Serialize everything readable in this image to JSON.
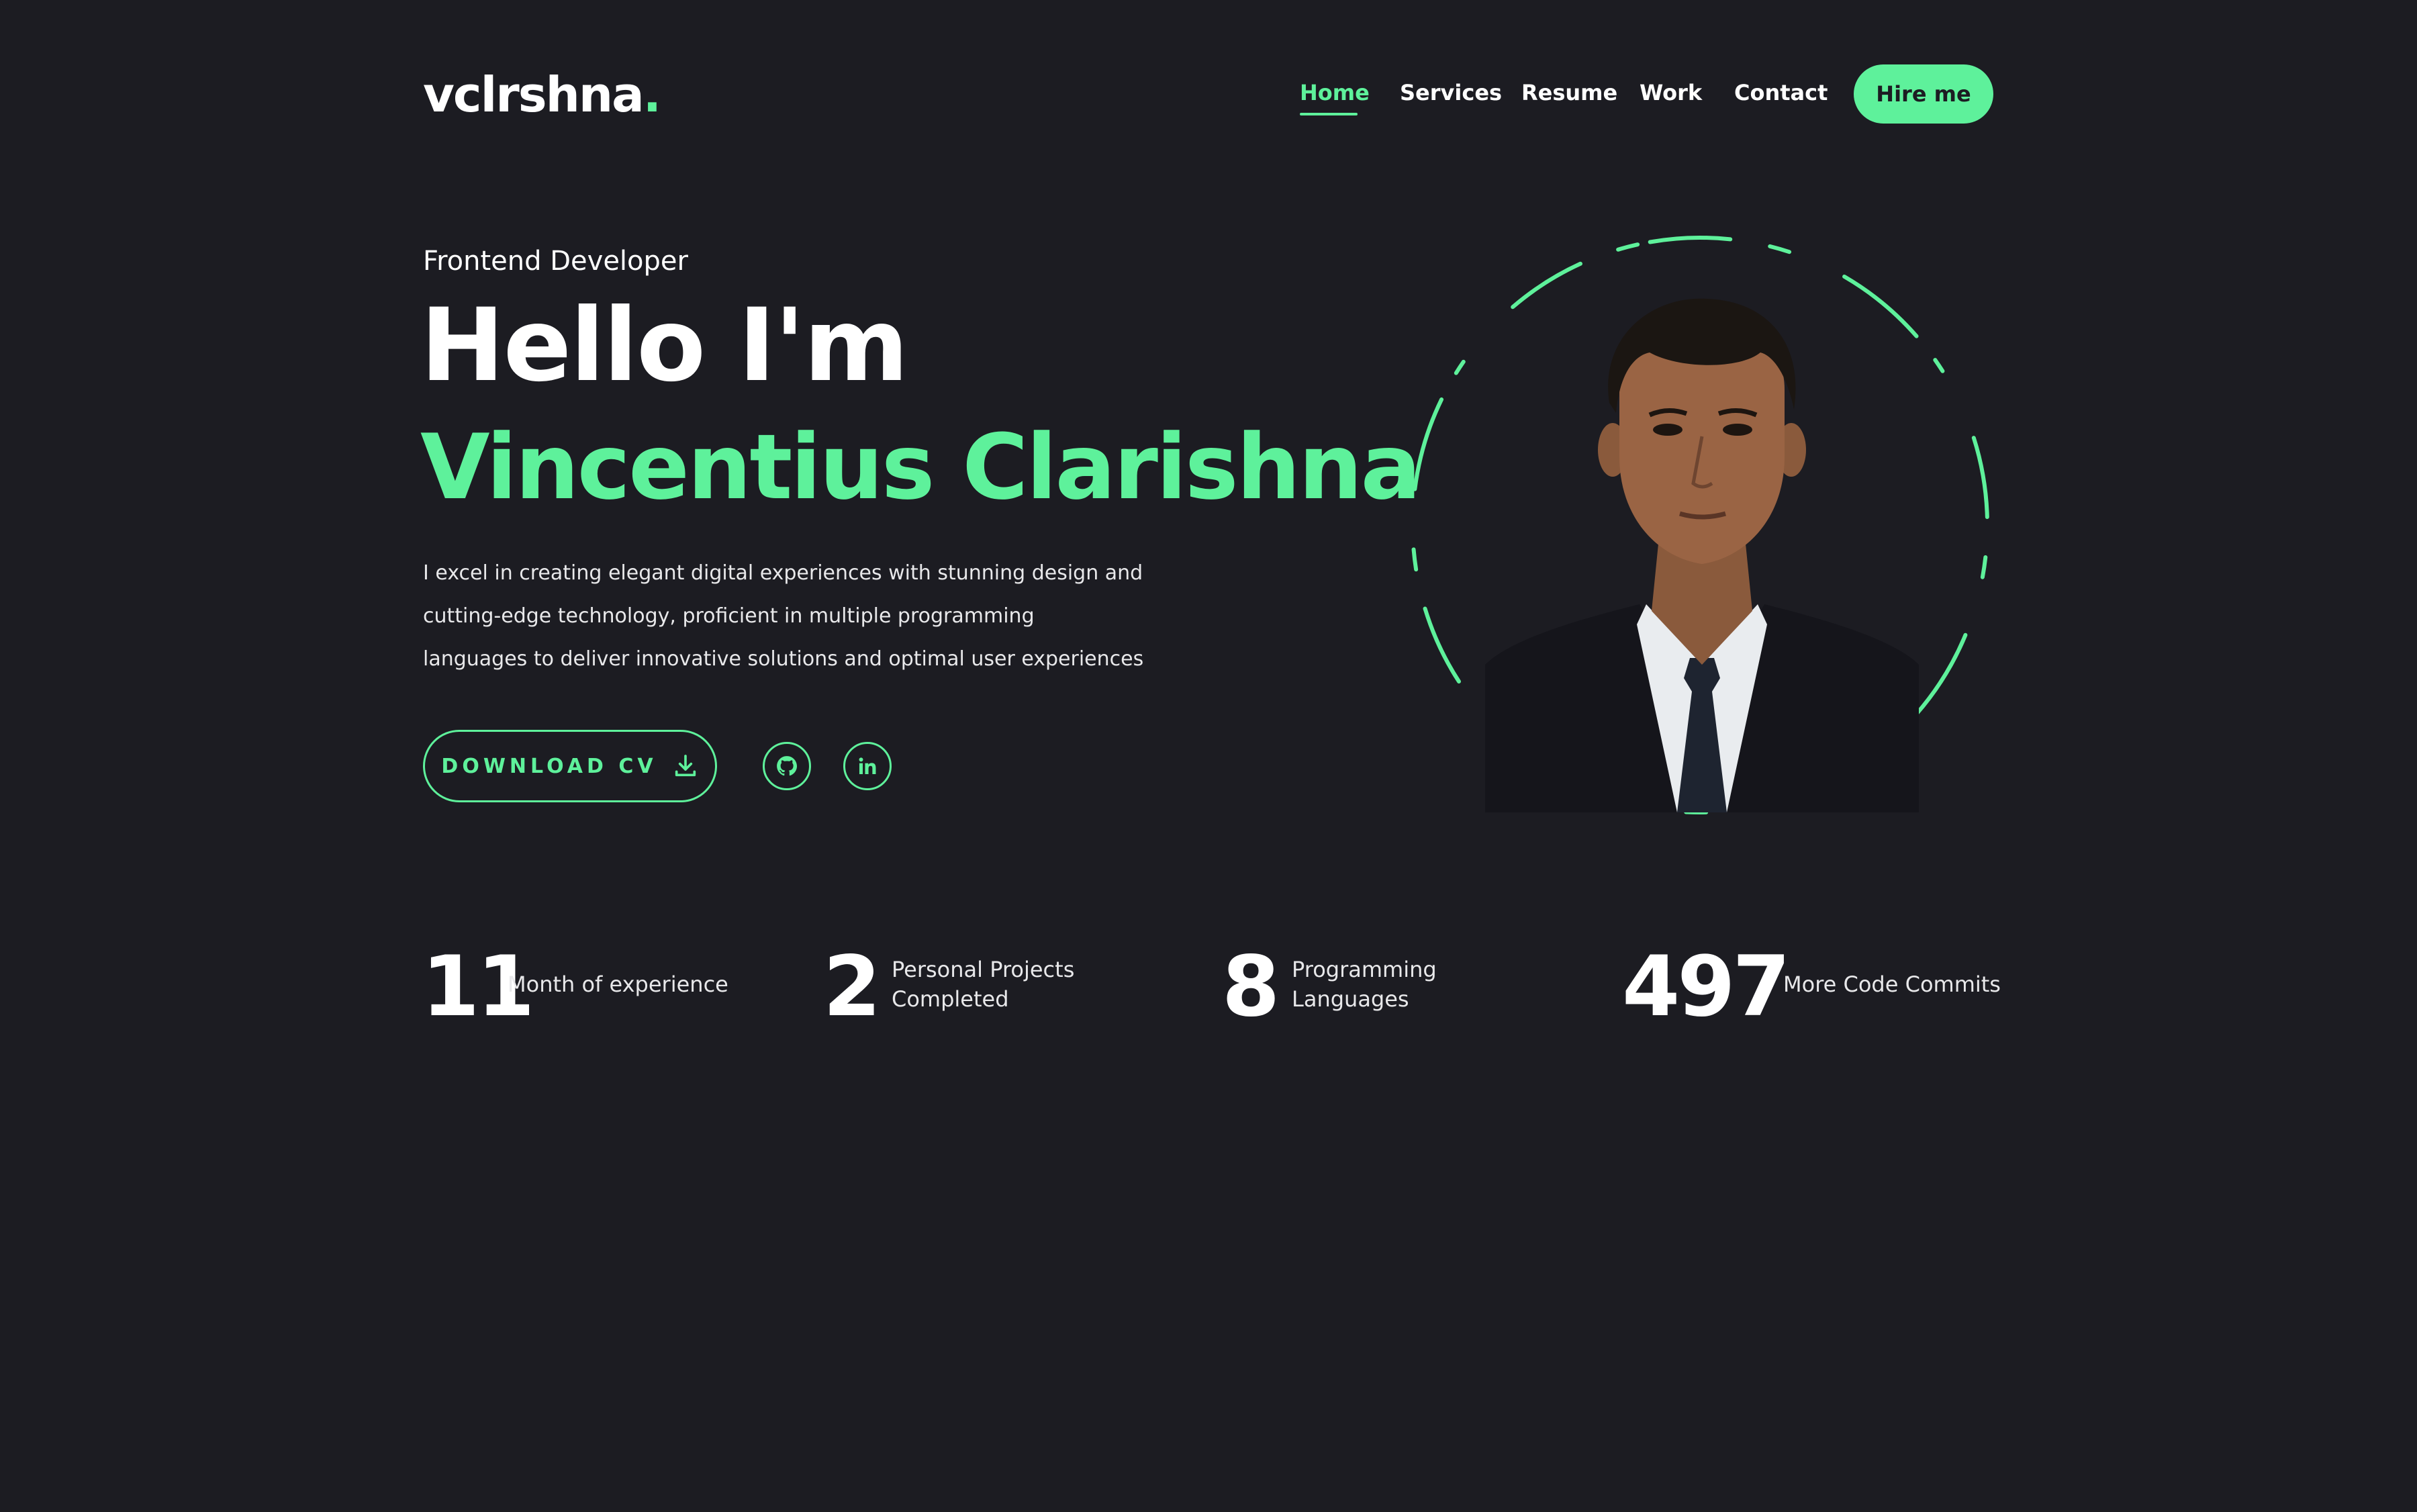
{
  "header": {
    "logo_text": "vclrshna",
    "logo_dot": ".",
    "nav": [
      {
        "label": "Home",
        "active": true
      },
      {
        "label": "Services",
        "active": false
      },
      {
        "label": "Resume",
        "active": false
      },
      {
        "label": "Work",
        "active": false
      },
      {
        "label": "Contact",
        "active": false
      }
    ],
    "cta_label": "Hire me"
  },
  "hero": {
    "role": "Frontend Developer",
    "greeting": "Hello I'm",
    "name": "Vincentius Clarishna",
    "description_lines": [
      "I excel in creating elegant digital experiences with stunning design and",
      "cutting-edge technology, proficient in multiple programming",
      "languages to deliver innovative solutions and optimal user experiences"
    ],
    "download_label": "DOWNLOAD CV",
    "download_icon": "download-icon",
    "socials": [
      {
        "icon": "github-icon"
      },
      {
        "icon": "linkedin-icon"
      }
    ]
  },
  "stats": [
    {
      "value": "11",
      "label_lines": [
        "Month of experience"
      ]
    },
    {
      "value": "2",
      "label_lines": [
        "Personal Projects",
        "Completed"
      ]
    },
    {
      "value": "8",
      "label_lines": [
        "Programming",
        "Languages"
      ]
    },
    {
      "value": "497",
      "label_lines": [
        "More Code Commits"
      ]
    }
  ],
  "colors": {
    "background": "#1c1c22",
    "accent": "#5ef19b",
    "text": "#ffffff"
  }
}
